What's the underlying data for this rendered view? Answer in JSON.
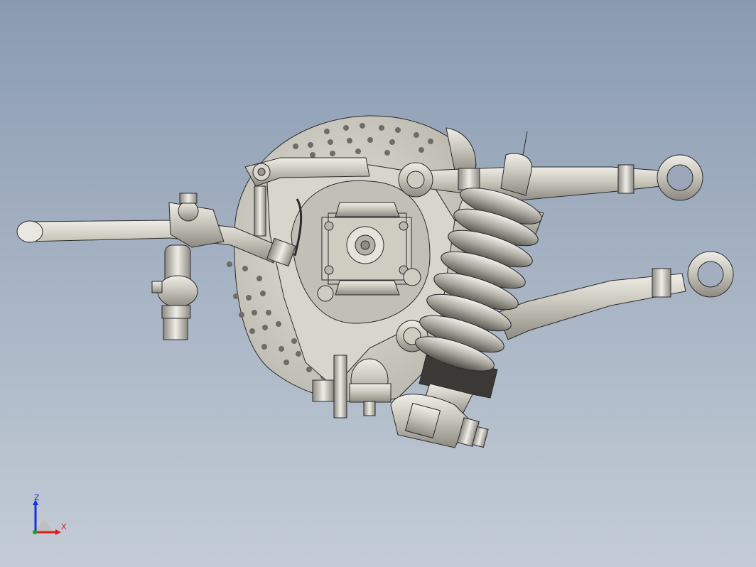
{
  "viewport": {
    "background_top": "#8a9bb1",
    "background_bottom": "#c3ccd6",
    "model_color": "#d2cfc6",
    "edge_color": "#2a2a2a"
  },
  "triad": {
    "z_label": "Z",
    "x_label": "X",
    "z_color": "#1a2ee0",
    "x_color": "#e01a1a",
    "y_color": "#1aa01a"
  }
}
